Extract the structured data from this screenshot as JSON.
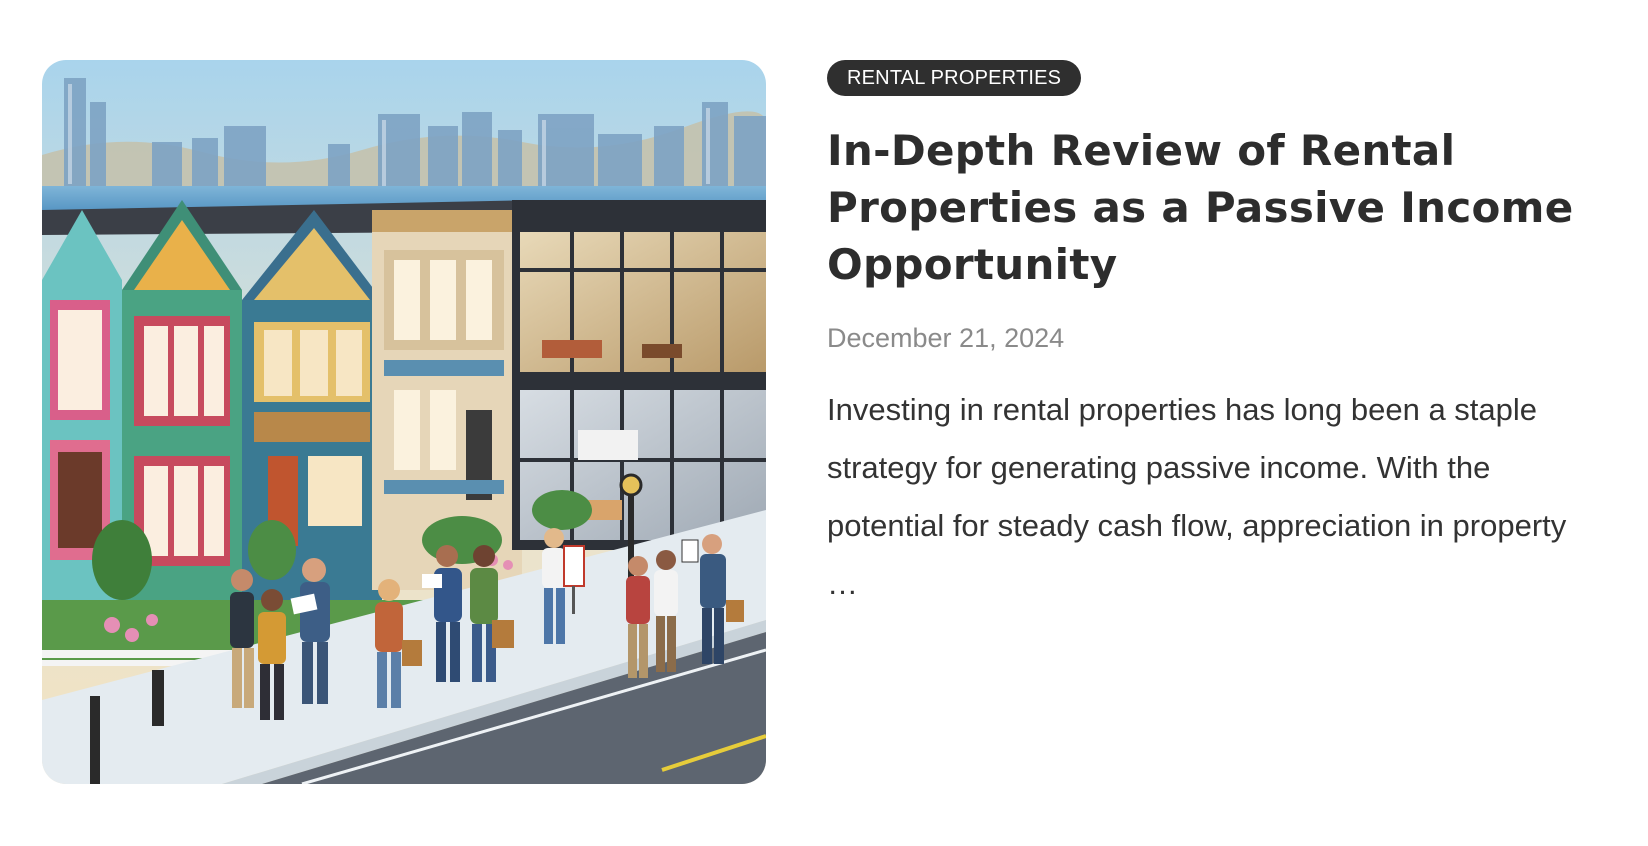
{
  "post": {
    "image_alt": "Illustration of colorful Victorian rental houses beside a modern glass building, with people holding documents and briefcases on the sidewalk and a city skyline across the water",
    "category": "RENTAL PROPERTIES",
    "title": "In-Depth Review of Rental Properties as a Passive Income Opportunity",
    "date": "December 21, 2024",
    "excerpt": "Investing in rental properties has long been a staple strategy for generating passive income. With the potential for steady cash flow, appreciation in property",
    "excerpt_more": "…"
  },
  "colors": {
    "badge_bg": "#2f2f2f",
    "title": "#2d2d2d",
    "date": "#8a8a8a",
    "text": "#333333"
  }
}
